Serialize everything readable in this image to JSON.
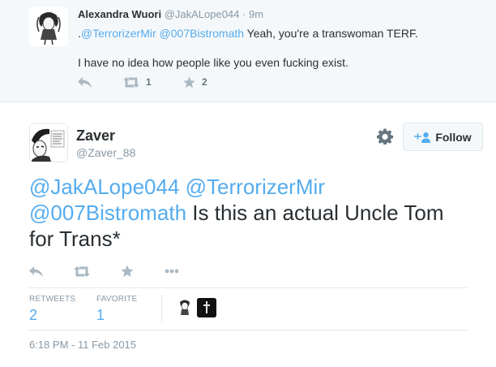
{
  "reply": {
    "name": "Alexandra Wuori",
    "handle": "@JakALope044",
    "dot": "·",
    "time": "9m",
    "text_prefix": ".",
    "mention1": "@TerrorizerMir",
    "mention2": "@007Bistromath",
    "text_rest": " Yeah, you're a transwoman TERF.",
    "text_line2": "I have no idea how people like you even fucking exist.",
    "retweet_count": "1",
    "favorite_count": "2"
  },
  "main": {
    "name": "Zaver",
    "handle": "@Zaver_88",
    "follow_label": "Follow",
    "mention1": "@JakALope044",
    "mention2": "@TerrorizerMir",
    "mention3": "@007Bistromath",
    "text_rest": " Is this an actual Uncle Tom for Trans*",
    "retweets_label": "RETWEETS",
    "retweets_value": "2",
    "favorites_label": "FAVORITE",
    "favorites_value": "1",
    "timestamp": "6:18 PM - 11 Feb 2015"
  },
  "colors": {
    "link": "#55acee",
    "icon": "#aab8c2",
    "muted": "#8899a6",
    "reply_bg": "#f5f8fa"
  },
  "icons": [
    "reply-icon",
    "retweet-icon",
    "star-icon",
    "more-icon",
    "gear-icon",
    "follow-person-icon"
  ]
}
